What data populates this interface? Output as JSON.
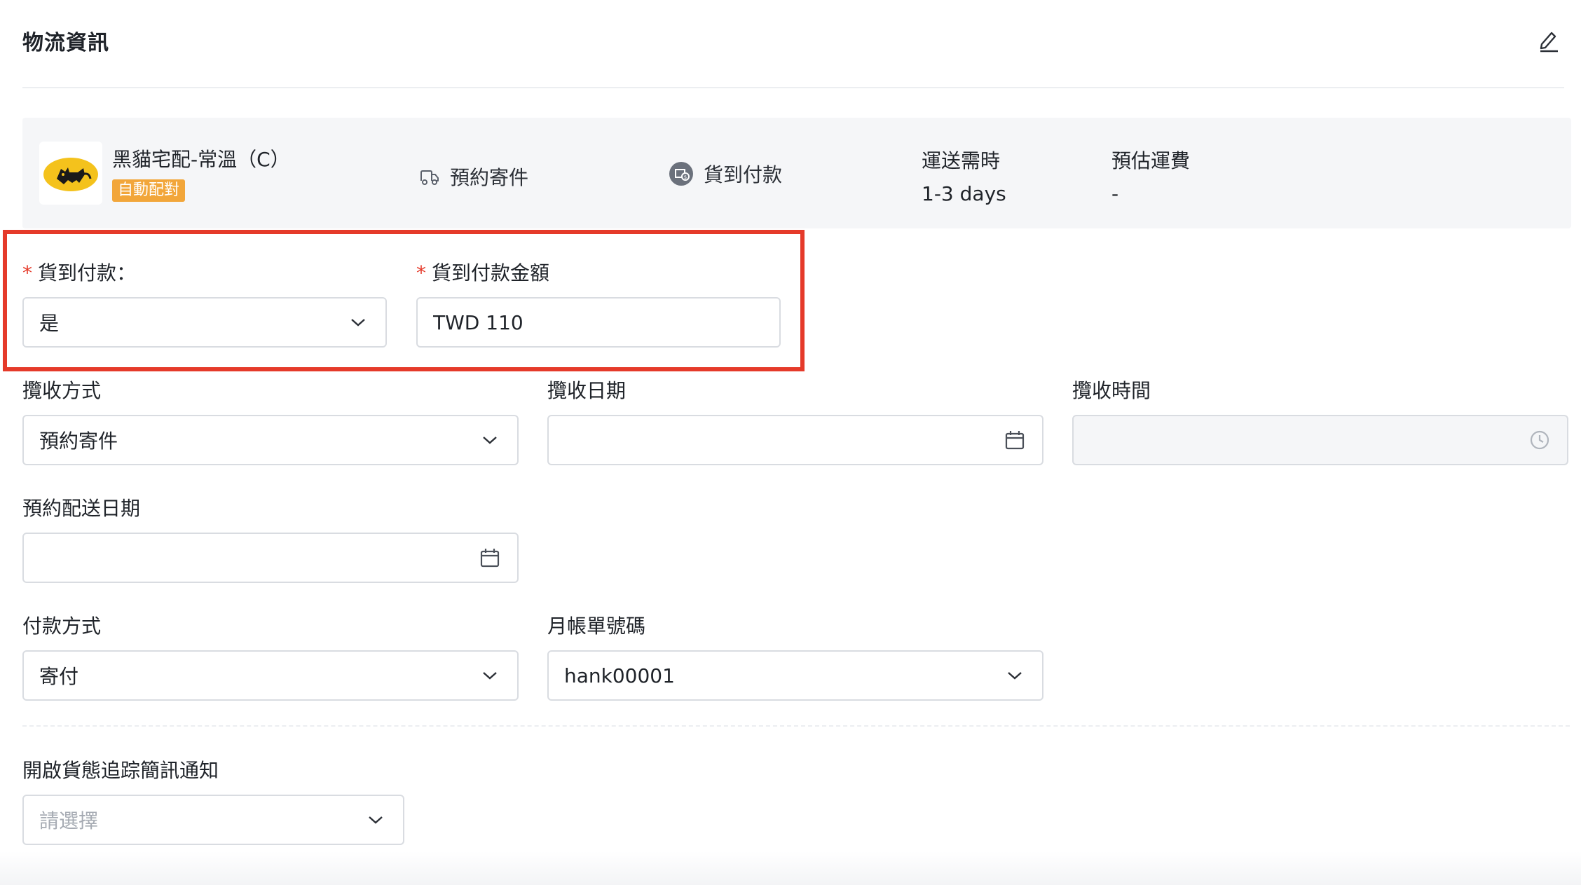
{
  "section_title": "物流資訊",
  "carrier": {
    "name": "黑貓宅配-常溫（C）",
    "badge": "自動配對",
    "pickup_type": "預約寄件",
    "payment": "貨到付款",
    "delivery_time_label": "運送需時",
    "delivery_time_value": "1-3 days",
    "fee_label": "預估運費",
    "fee_value": "-"
  },
  "cod": {
    "label": "貨到付款：",
    "value": "是",
    "amount_label": "貨到付款金額",
    "amount_value": "TWD 110"
  },
  "pickup": {
    "method_label": "攬收方式",
    "method_value": "預約寄件",
    "date_label": "攬收日期",
    "date_value": "",
    "time_label": "攬收時間",
    "time_value": ""
  },
  "delivery_date": {
    "label": "預約配送日期",
    "value": ""
  },
  "payment_method": {
    "label": "付款方式",
    "value": "寄付"
  },
  "monthly_account": {
    "label": "月帳單號碼",
    "value": "hank00001"
  },
  "sms": {
    "label": "開啟貨態追踪簡訊通知",
    "placeholder": "請選擇"
  },
  "colors": {
    "required": "#e53a2a",
    "highlight_border": "#e53a2a",
    "badge_bg": "#f2a63a",
    "card_bg": "#f5f6f8"
  },
  "icons": [
    "edit-icon",
    "black-cat-logo",
    "truck-icon",
    "cod-icon",
    "chevron-down-icon",
    "calendar-icon",
    "clock-icon"
  ]
}
